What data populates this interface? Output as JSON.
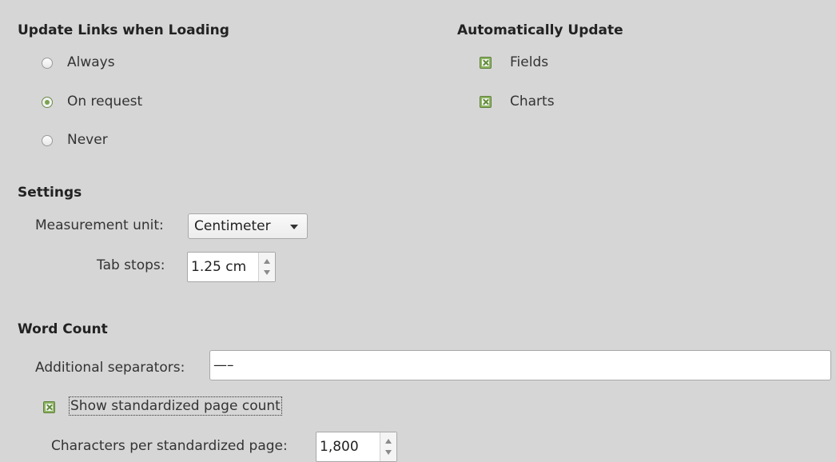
{
  "update_links": {
    "heading": "Update Links when Loading",
    "options": [
      {
        "label": "Always",
        "selected": false
      },
      {
        "label": "On request",
        "selected": true
      },
      {
        "label": "Never",
        "selected": false
      }
    ]
  },
  "auto_update": {
    "heading": "Automatically Update",
    "items": [
      {
        "label": "Fields",
        "checked": true
      },
      {
        "label": "Charts",
        "checked": true
      }
    ]
  },
  "settings": {
    "heading": "Settings",
    "measurement_unit": {
      "label": "Measurement unit:",
      "value": "Centimeter"
    },
    "tab_stops": {
      "label": "Tab stops:",
      "value": "1.25 cm"
    }
  },
  "word_count": {
    "heading": "Word Count",
    "separators": {
      "label": "Additional separators:",
      "value": "—–"
    },
    "show_standardized": {
      "label": "Show standardized page count",
      "checked": true
    },
    "chars_per_page": {
      "label": "Characters per standardized page:",
      "value": "1,800"
    }
  },
  "colors": {
    "background": "#d6d6d6",
    "accent_green": "#8cb45f",
    "radio_dot": "#7aa34f"
  }
}
